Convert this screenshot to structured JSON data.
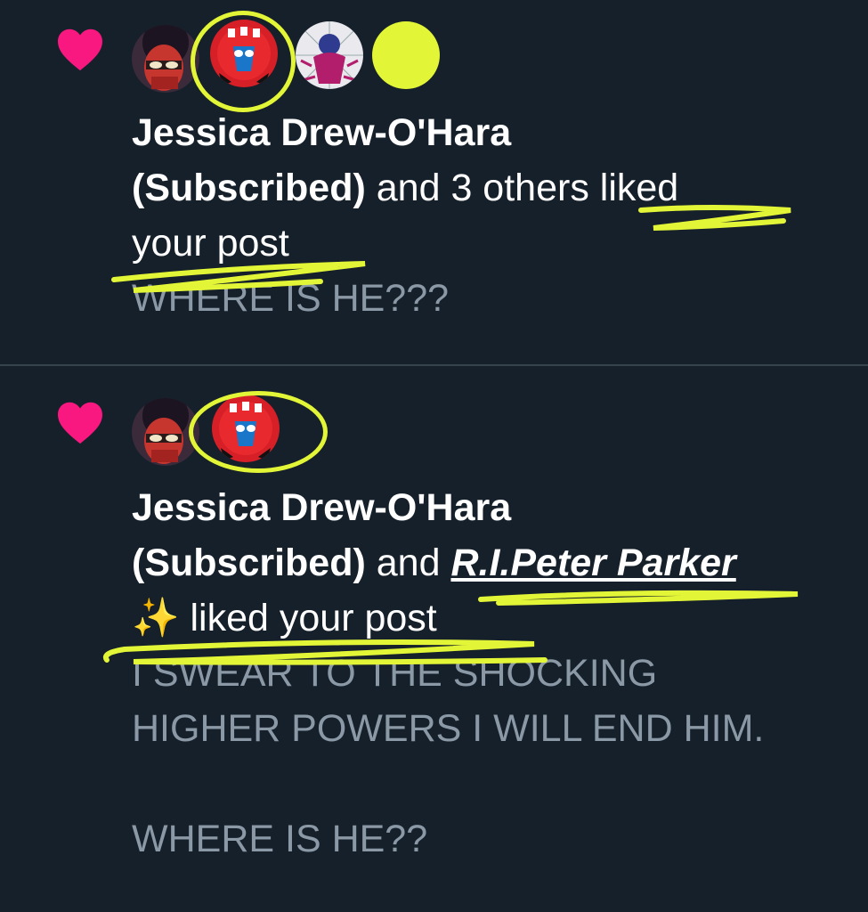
{
  "colors": {
    "background": "#15202b",
    "heart": "#f91880",
    "highlight": "#e3f537",
    "divider": "#38444d",
    "muted_text": "#8b98a5"
  },
  "notifications": [
    {
      "icon": "heart-icon",
      "user_name": "Jessica Drew-O'Hara",
      "subscribed": "(Subscribed)",
      "connector": " and 3 others liked",
      "action": "your post",
      "post_text": "WHERE IS HE???"
    },
    {
      "icon": "heart-icon",
      "user_name": "Jessica Drew-O'Hara",
      "subscribed": "(Subscribed)",
      "connector": " and ",
      "second_user": "R.I.Peter Parker",
      "emoji": "✨",
      "action": " liked your post",
      "post_line_1": "I SWEAR TO THE SHOCKING",
      "post_line_2": "HIGHER POWERS I WILL END HIM.",
      "post_line_3": "WHERE IS HE??"
    }
  ]
}
